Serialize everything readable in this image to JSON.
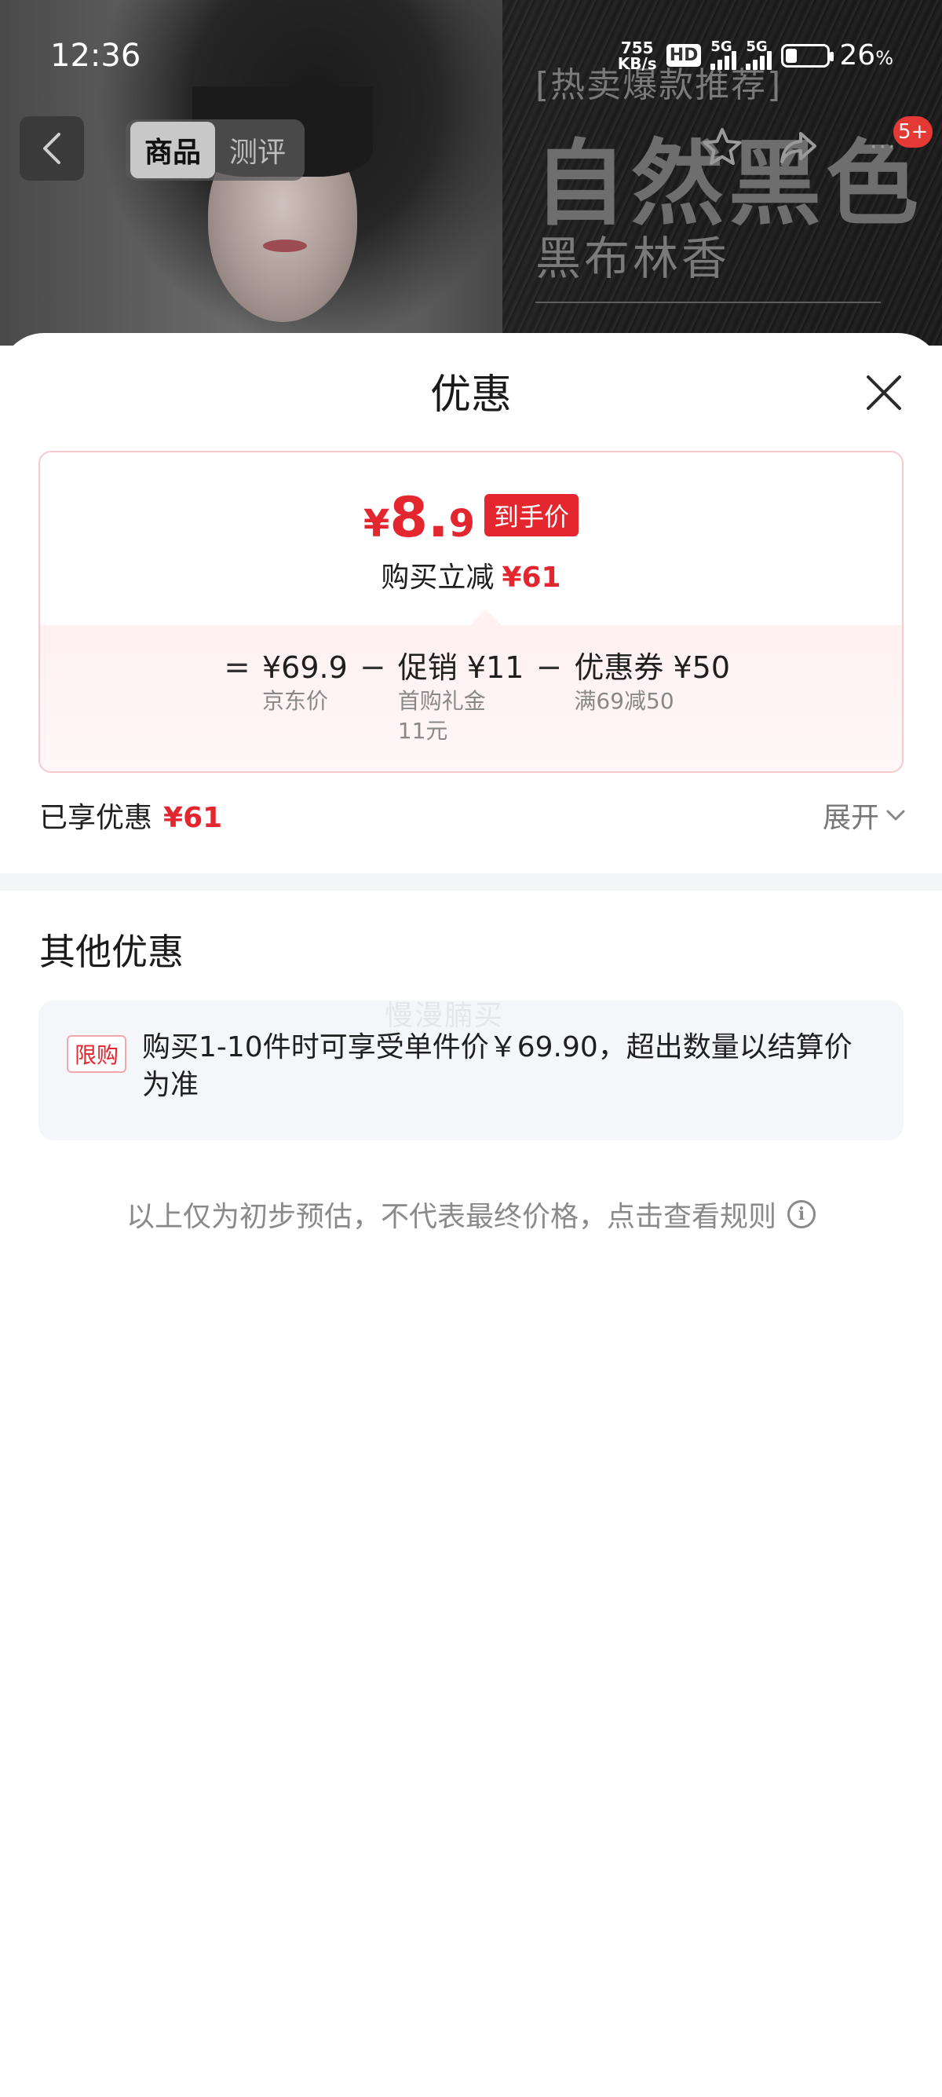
{
  "status_bar": {
    "time": "12:36",
    "net_speed_value": "755",
    "net_speed_unit": "KB/s",
    "hd_label": "HD",
    "signal1_label": "5G",
    "signal2_label": "5G",
    "battery_percent": "26",
    "battery_unit": "%",
    "battery_level": 0.26
  },
  "background_promo": {
    "tag": "[热卖爆款推荐]",
    "title": "自然黑色",
    "subtitle": "黑布林香"
  },
  "top_nav": {
    "tabs": [
      {
        "label": "商品",
        "active": true
      },
      {
        "label": "测评",
        "active": false
      }
    ],
    "notification_count": "5+"
  },
  "sheet": {
    "title": "优惠",
    "price_card": {
      "currency": "¥",
      "final_price_int": "8.",
      "final_price_dec": "9",
      "final_tag": "到手价",
      "reduce_label": "购买立减",
      "reduce_amount": "¥61",
      "formula": {
        "equals": "=",
        "minus": "−",
        "base_price": "¥69.9",
        "base_label": "京东价",
        "promo": "促销 ¥11",
        "promo_note_line1": "首购礼金",
        "promo_note_line2": "11元",
        "coupon": "优惠券 ¥50",
        "coupon_note": "满69减50"
      }
    },
    "enjoyed_label": "已享优惠",
    "enjoyed_amount": "¥61",
    "expand_label": "展开",
    "other_title": "其他优惠",
    "watermark": "慢漫腩买",
    "limit_tag": "限购",
    "limit_text": "购买1-10件时可享受单件价￥69.90，超出数量以结算价为准",
    "disclaimer": "以上仅为初步预估，不代表最终价格，点击查看规则"
  },
  "colors": {
    "accent_red": "#e4262f",
    "sheet_bg": "#ffffff",
    "card_border": "#f6c9cf"
  },
  "icons": [
    "back-arrow-icon",
    "star-icon",
    "share-icon",
    "more-icon",
    "close-icon",
    "chevron-down-icon",
    "info-icon"
  ]
}
